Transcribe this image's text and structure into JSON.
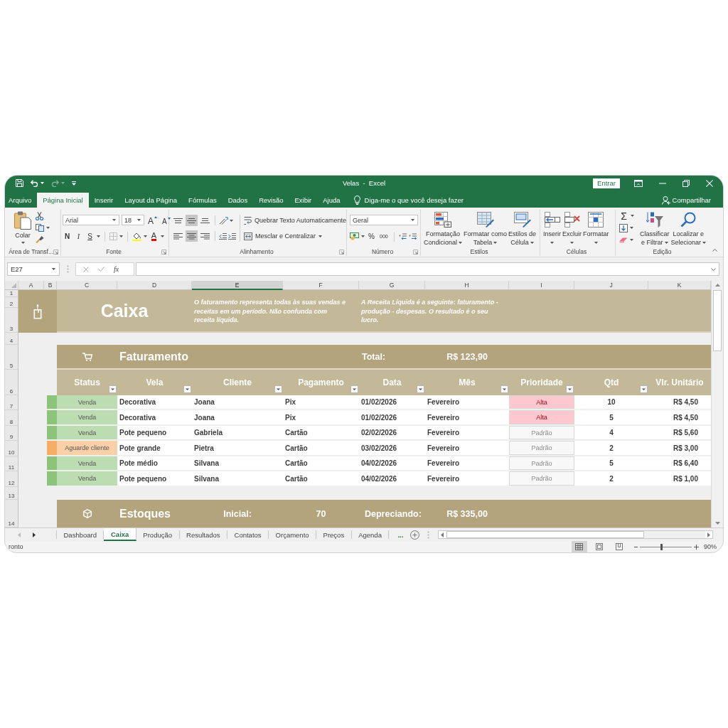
{
  "title_bar": {
    "title": "Velas  -  Excel",
    "sign_in": "Entrar"
  },
  "ribbon_tabs": [
    {
      "label": "Arquivo",
      "selected": false
    },
    {
      "label": "Página Inicial",
      "selected": true
    },
    {
      "label": "Inserir",
      "selected": false
    },
    {
      "label": "Layout da Página",
      "selected": false
    },
    {
      "label": "Fórmulas",
      "selected": false
    },
    {
      "label": "Dados",
      "selected": false
    },
    {
      "label": "Revisão",
      "selected": false
    },
    {
      "label": "Exibir",
      "selected": false
    },
    {
      "label": "Ajuda",
      "selected": false
    }
  ],
  "tell_me": {
    "placeholder": "Diga-me o que você deseja fazer"
  },
  "share": "Compartilhar",
  "ribbon_groups": [
    {
      "kind": "clipboard",
      "label": "Área de Transf...",
      "launcher": true,
      "paste": "Colar"
    },
    {
      "kind": "font",
      "label": "Fonte",
      "launcher": true,
      "font": "Arial",
      "size": "18",
      "grow": "A",
      "shrink": "A",
      "bold": "N",
      "italic": "I",
      "underline": "S",
      "font_color": "A"
    },
    {
      "kind": "alignment",
      "label": "Alinhamento",
      "launcher": true,
      "vertical": [
        {
          "kind": "top",
          "selected": false
        },
        {
          "kind": "middle",
          "selected": true
        },
        {
          "kind": "bottom",
          "selected": false
        }
      ],
      "horizontal": [
        {
          "kind": "left",
          "selected": false
        },
        {
          "kind": "center",
          "selected": true
        },
        {
          "kind": "right",
          "selected": false
        }
      ],
      "wrap": "Quebrar Texto Automaticamente",
      "merge": "Mesclar e Centralizar"
    },
    {
      "kind": "number",
      "label": "Número",
      "launcher": true,
      "format": "Geral",
      "percent": "%",
      "thousands": "000"
    },
    {
      "kind": "styles",
      "label": "Estilos",
      "launcher": false,
      "buttons": [
        {
          "kind": "conditional",
          "lines": [
            "Formatação",
            "Condicional"
          ]
        },
        {
          "kind": "table",
          "lines": [
            "Formatar como",
            "Tabela"
          ]
        },
        {
          "kind": "cell",
          "lines": [
            "Estilos de",
            "Célula"
          ]
        }
      ]
    },
    {
      "kind": "cells",
      "label": "Células",
      "launcher": false,
      "buttons": [
        {
          "kind": "insert",
          "lines": [
            "Inserir"
          ]
        },
        {
          "kind": "delete",
          "lines": [
            "Excluir"
          ]
        },
        {
          "kind": "format",
          "lines": [
            "Formatar"
          ]
        }
      ]
    },
    {
      "kind": "editing",
      "label": "Edição",
      "launcher": false,
      "sum": "Σ",
      "buttons": [
        {
          "kind": "sort",
          "lines": [
            "Classificar",
            "e Filtrar"
          ]
        },
        {
          "kind": "find",
          "lines": [
            "Localizar e",
            "Selecionar"
          ]
        }
      ]
    }
  ],
  "formula_bar": {
    "name_box": "E27",
    "function_label": "fx"
  },
  "columns": [
    {
      "label": "A",
      "selected": false
    },
    {
      "label": "B",
      "selected": false
    },
    {
      "label": "C",
      "selected": false
    },
    {
      "label": "D",
      "selected": false
    },
    {
      "label": "E",
      "selected": true
    },
    {
      "label": "F",
      "selected": false
    },
    {
      "label": "G",
      "selected": false
    },
    {
      "label": "H",
      "selected": false
    },
    {
      "label": "I",
      "selected": false
    },
    {
      "label": "J",
      "selected": false
    },
    {
      "label": "K",
      "selected": false
    }
  ],
  "row_numbers": [
    "1",
    "2",
    "3",
    "4",
    "5",
    "6",
    "7",
    "8",
    "9",
    "10",
    "11",
    "12",
    "13",
    "14"
  ],
  "banner": {
    "title": "Caixa",
    "notes": [
      "O faturamento representa todas às suas vendas e receitas em um período. Não confunda com receita líquida.",
      "A Receita Líquida é a seguinte: faturamento - produção - despesas. O resultado é o seu lucro."
    ]
  },
  "faturamento": {
    "title": "Faturamento",
    "total_label": "Total:",
    "total": "R$ 123,90"
  },
  "table": {
    "columns": [
      {
        "label": "Status",
        "filter": true
      },
      {
        "label": "Vela",
        "filter": true
      },
      {
        "label": "Cliente",
        "filter": true
      },
      {
        "label": "Pagamento",
        "filter": true
      },
      {
        "label": "Data",
        "filter": true
      },
      {
        "label": "Mês",
        "filter": true
      },
      {
        "label": "Prioridade",
        "filter": true
      },
      {
        "label": "Qtd",
        "filter": true
      },
      {
        "label": "Vlr. Unitário",
        "filter": false
      }
    ],
    "rows": [
      {
        "color": "#8cc47a",
        "status": "Venda",
        "vela": "Decorativa",
        "cliente": "Joana",
        "pagamento": "Pix",
        "data": "01/02/2026",
        "mes": "Fevereiro",
        "priority": {
          "kind": "high",
          "text": "Alta"
        },
        "qtd": "10",
        "valor": "R$ 4,50"
      },
      {
        "color": "#8cc47a",
        "status": "Venda",
        "vela": "Decorativa",
        "cliente": "Joana",
        "pagamento": "Pix",
        "data": "01/02/2026",
        "mes": "Fevereiro",
        "priority": {
          "kind": "high",
          "text": "Alta"
        },
        "qtd": "5",
        "valor": "R$ 4,50"
      },
      {
        "color": "#8cc47a",
        "status": "Venda",
        "vela": "Pote pequeno",
        "cliente": "Gabriela",
        "pagamento": "Cartão",
        "data": "02/02/2026",
        "mes": "Fevereiro",
        "priority": {
          "kind": "standard",
          "text": "Padrão"
        },
        "qtd": "4",
        "valor": "R$ 5,60"
      },
      {
        "color": "#f4ae68",
        "status": "Aguarde cliente",
        "vela": "Pote grande",
        "cliente": "Pietra",
        "pagamento": "Cartão",
        "data": "03/02/2026",
        "mes": "Fevereiro",
        "priority": {
          "kind": "standard",
          "text": "Padrão"
        },
        "qtd": "2",
        "valor": "R$ 3,00"
      },
      {
        "color": "#8cc47a",
        "status": "Venda",
        "vela": "Pote médio",
        "cliente": "Silvana",
        "pagamento": "Cartão",
        "data": "04/02/2026",
        "mes": "Fevereiro",
        "priority": {
          "kind": "standard",
          "text": "Padrão"
        },
        "qtd": "5",
        "valor": "R$ 6,40"
      },
      {
        "color": "#8cc47a",
        "status": "Venda",
        "vela": "Pote pequeno",
        "cliente": "Silvana",
        "pagamento": "Cartão",
        "data": "04/02/2026",
        "mes": "Fevereiro",
        "priority": {
          "kind": "standard",
          "text": "Padrão"
        },
        "qtd": "2",
        "valor": "R$ 1,00"
      }
    ]
  },
  "estoques": {
    "title": "Estoques",
    "initial_label": "Inicial:",
    "initial": "70",
    "depreciation_label": "Depreciando:",
    "depreciation": "R$ 335,00"
  },
  "sheet_tabs": [
    {
      "label": "Dashboard",
      "selected": false
    },
    {
      "label": "Caixa",
      "selected": true
    },
    {
      "label": "Produção",
      "selected": false
    },
    {
      "label": "Resultados",
      "selected": false
    },
    {
      "label": "Contatos",
      "selected": false
    },
    {
      "label": "Orçamento",
      "selected": false
    },
    {
      "label": "Preços",
      "selected": false
    },
    {
      "label": "Agenda",
      "selected": false
    }
  ],
  "more_sheets": "...",
  "status_bar": {
    "status": "ronto",
    "views": [
      {
        "kind": "normal",
        "selected": true
      },
      {
        "kind": "page_layout",
        "selected": false
      },
      {
        "kind": "page_break",
        "selected": false
      }
    ],
    "zoom": {
      "level": 0.42,
      "reading": "90%"
    }
  }
}
